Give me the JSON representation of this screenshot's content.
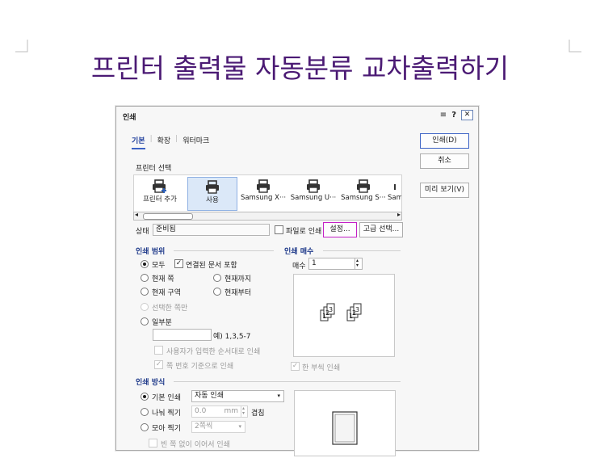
{
  "page": {
    "title": "프린터 출력물 자동분류 교차출력하기"
  },
  "dialog": {
    "title": "인쇄",
    "controls": {
      "options_icon": "≡",
      "help": "?",
      "close": "✕"
    },
    "tabs": [
      "기본",
      "확장",
      "워터마크"
    ],
    "side_buttons": {
      "print": "인쇄(D)",
      "cancel": "취소",
      "preview": "미리 보기(V)"
    },
    "printer_select": {
      "label": "프린터 선택",
      "items": [
        "프린터 추가",
        "사용",
        "Samsung X···",
        "Samsung U···",
        "Samsung S···",
        "Sam"
      ]
    },
    "status": {
      "label": "상태",
      "value": "준비됨",
      "print_to_file": "파일로 인쇄",
      "settings": "설정...",
      "advanced": "고급 선택..."
    },
    "range": {
      "section": "인쇄 범위",
      "all": "모두",
      "linked": "연결된 문서 포함",
      "current_page": "현재 쪽",
      "until_current": "현재까지",
      "current_section": "현재 구역",
      "from_current": "현재부터",
      "selection_only": "선택한 쪽만",
      "partial": "일부분",
      "partial_example": "예) 1,3,5-7",
      "user_order": "사용자가 입력한 순서대로 인쇄",
      "page_number_basis": "쪽 번호 기준으로 인쇄"
    },
    "copies": {
      "section": "인쇄 매수",
      "label": "매수",
      "value": "1",
      "collate": "한 부씩 인쇄"
    },
    "method": {
      "section": "인쇄 방식",
      "basic": "기본 인쇄",
      "basic_value": "자동 인쇄",
      "split": "나눠 찍기",
      "split_value": "0.0",
      "split_unit": "mm",
      "overlap": "겹침",
      "gather": "모아 찍기",
      "gather_value": "2쪽씩",
      "no_blank": "빈 쪽 없이 이어서 인쇄"
    }
  }
}
